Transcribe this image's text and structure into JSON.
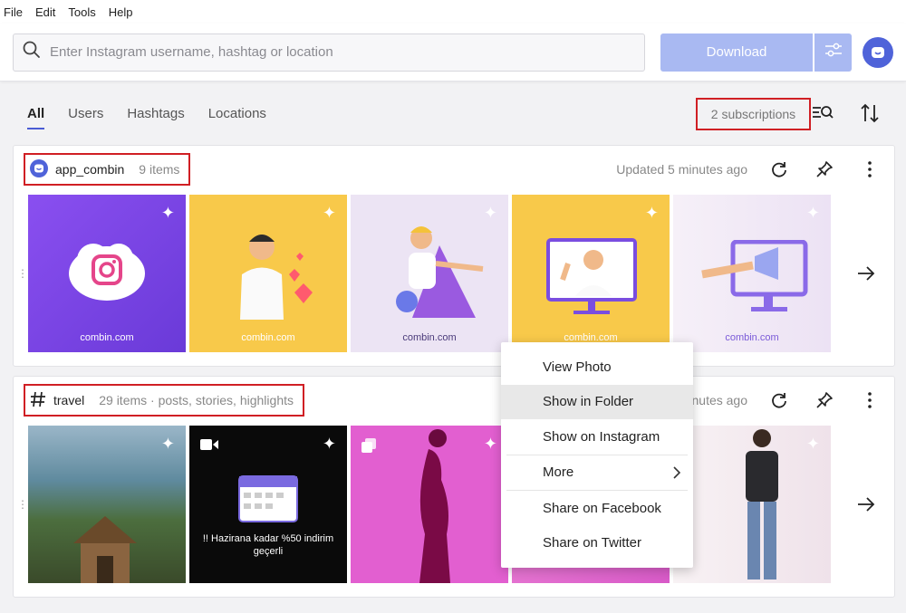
{
  "menu": [
    "File",
    "Edit",
    "Tools",
    "Help"
  ],
  "search": {
    "placeholder": "Enter Instagram username, hashtag or location"
  },
  "toolbar": {
    "download_label": "Download"
  },
  "tabs": [
    {
      "label": "All",
      "active": true
    },
    {
      "label": "Users",
      "active": false
    },
    {
      "label": "Hashtags",
      "active": false
    },
    {
      "label": "Locations",
      "active": false
    }
  ],
  "subscriptions_label": "2 subscriptions",
  "cards": [
    {
      "name": "app_combin",
      "count": "9 items",
      "updated": "Updated 5 minutes ago",
      "thumbs": [
        {
          "caption": "combin.com",
          "bg": "#7a45e0"
        },
        {
          "caption": "combin.com",
          "bg": "#f8c94a"
        },
        {
          "caption": "combin.com",
          "bg": "#ece4f4"
        },
        {
          "caption": "combin.com",
          "bg": "#f8c94a"
        },
        {
          "caption": "combin.com",
          "bg": "#f3eef8"
        }
      ]
    },
    {
      "name": "travel",
      "count": "29 items · posts, stories, highlights",
      "updated": "nutes ago",
      "thumbs": [
        {
          "caption": "",
          "bg": "#5f7a5c"
        },
        {
          "caption": "!! Hazirana kadar %50 indirim geçerli",
          "bg": "#0a0a0a"
        },
        {
          "caption": "",
          "bg": "#e25fd0"
        },
        {
          "caption": "",
          "bg": "#e27fd6"
        },
        {
          "caption": "",
          "bg": "#f1e8ef"
        }
      ]
    }
  ],
  "context_menu": {
    "items": [
      "View Photo",
      "Show in Folder",
      "Show on Instagram",
      "More",
      "Share on Facebook",
      "Share on Twitter"
    ],
    "hovered": "Show in Folder"
  },
  "colors": {
    "accent": "#4a5bd4",
    "download_bg": "#a9b9f2",
    "highlight_border": "#d01f24"
  }
}
